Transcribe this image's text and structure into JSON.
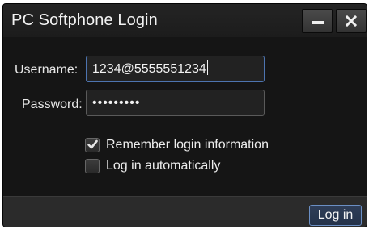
{
  "window": {
    "title": "PC Softphone Login"
  },
  "form": {
    "username_label": "Username:",
    "username_value": "1234@5555551234",
    "password_label": "Password:",
    "password_value": "•••••••••",
    "remember_label": "Remember login information",
    "remember_checked": true,
    "auto_label": "Log in automatically",
    "auto_checked": false
  },
  "footer": {
    "login_label": "Log in"
  },
  "icons": {
    "minimize": "minimize-icon",
    "close": "close-icon",
    "check": "checkmark-icon"
  },
  "colors": {
    "window_bg": "#161616",
    "footer_bg": "#2b2b2b",
    "focus_border": "#4d74b0",
    "button_border": "#6b8fc4"
  }
}
